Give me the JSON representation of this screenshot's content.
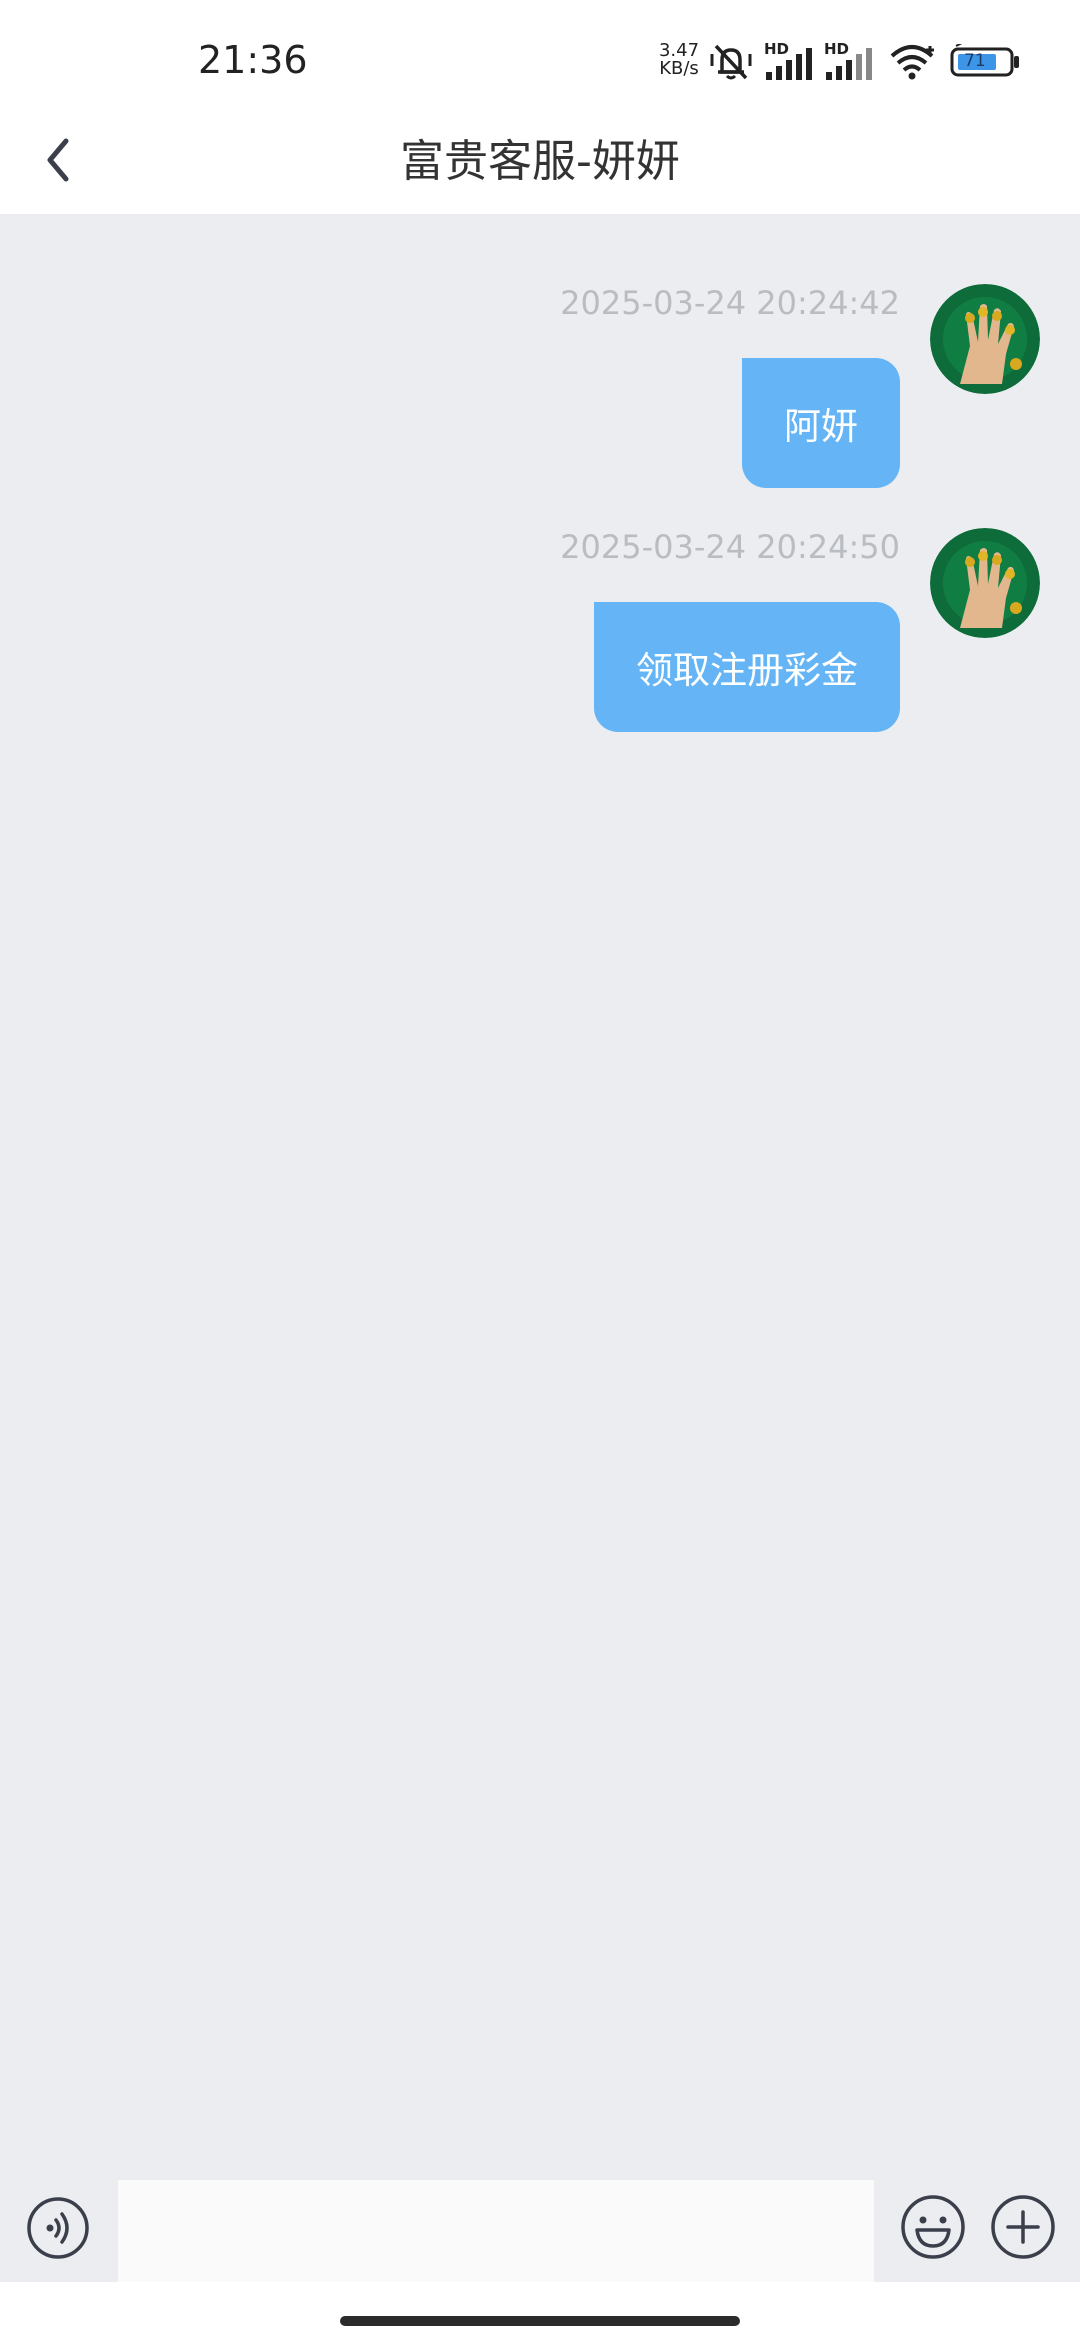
{
  "status_bar": {
    "time": "21:36",
    "net_speed_value": "3.47",
    "net_speed_unit": "KB/s",
    "signal_1_label": "HD",
    "signal_2_label": "HD",
    "battery_level": "71",
    "icons": [
      "mute-icon",
      "signal-icon",
      "signal-icon",
      "wifi-icon",
      "battery-icon"
    ]
  },
  "header": {
    "title": "富贵客服-妍妍",
    "back_icon": "chevron-left-icon"
  },
  "messages": [
    {
      "time": "2025-03-24 20:24:42",
      "text": "阿妍",
      "sender": "self"
    },
    {
      "time": "2025-03-24 20:24:50",
      "text": "领取注册彩金",
      "sender": "self"
    }
  ],
  "input_bar": {
    "value": "",
    "placeholder": "",
    "left_icon": "voice-icon",
    "right_icons": [
      "emoji-icon",
      "plus-icon"
    ]
  },
  "colors": {
    "chat_background": "#ebedf0",
    "bubble": "#65b5f6",
    "timestamp": "#b9bcc1",
    "avatar_background": "#0e6b3a"
  }
}
